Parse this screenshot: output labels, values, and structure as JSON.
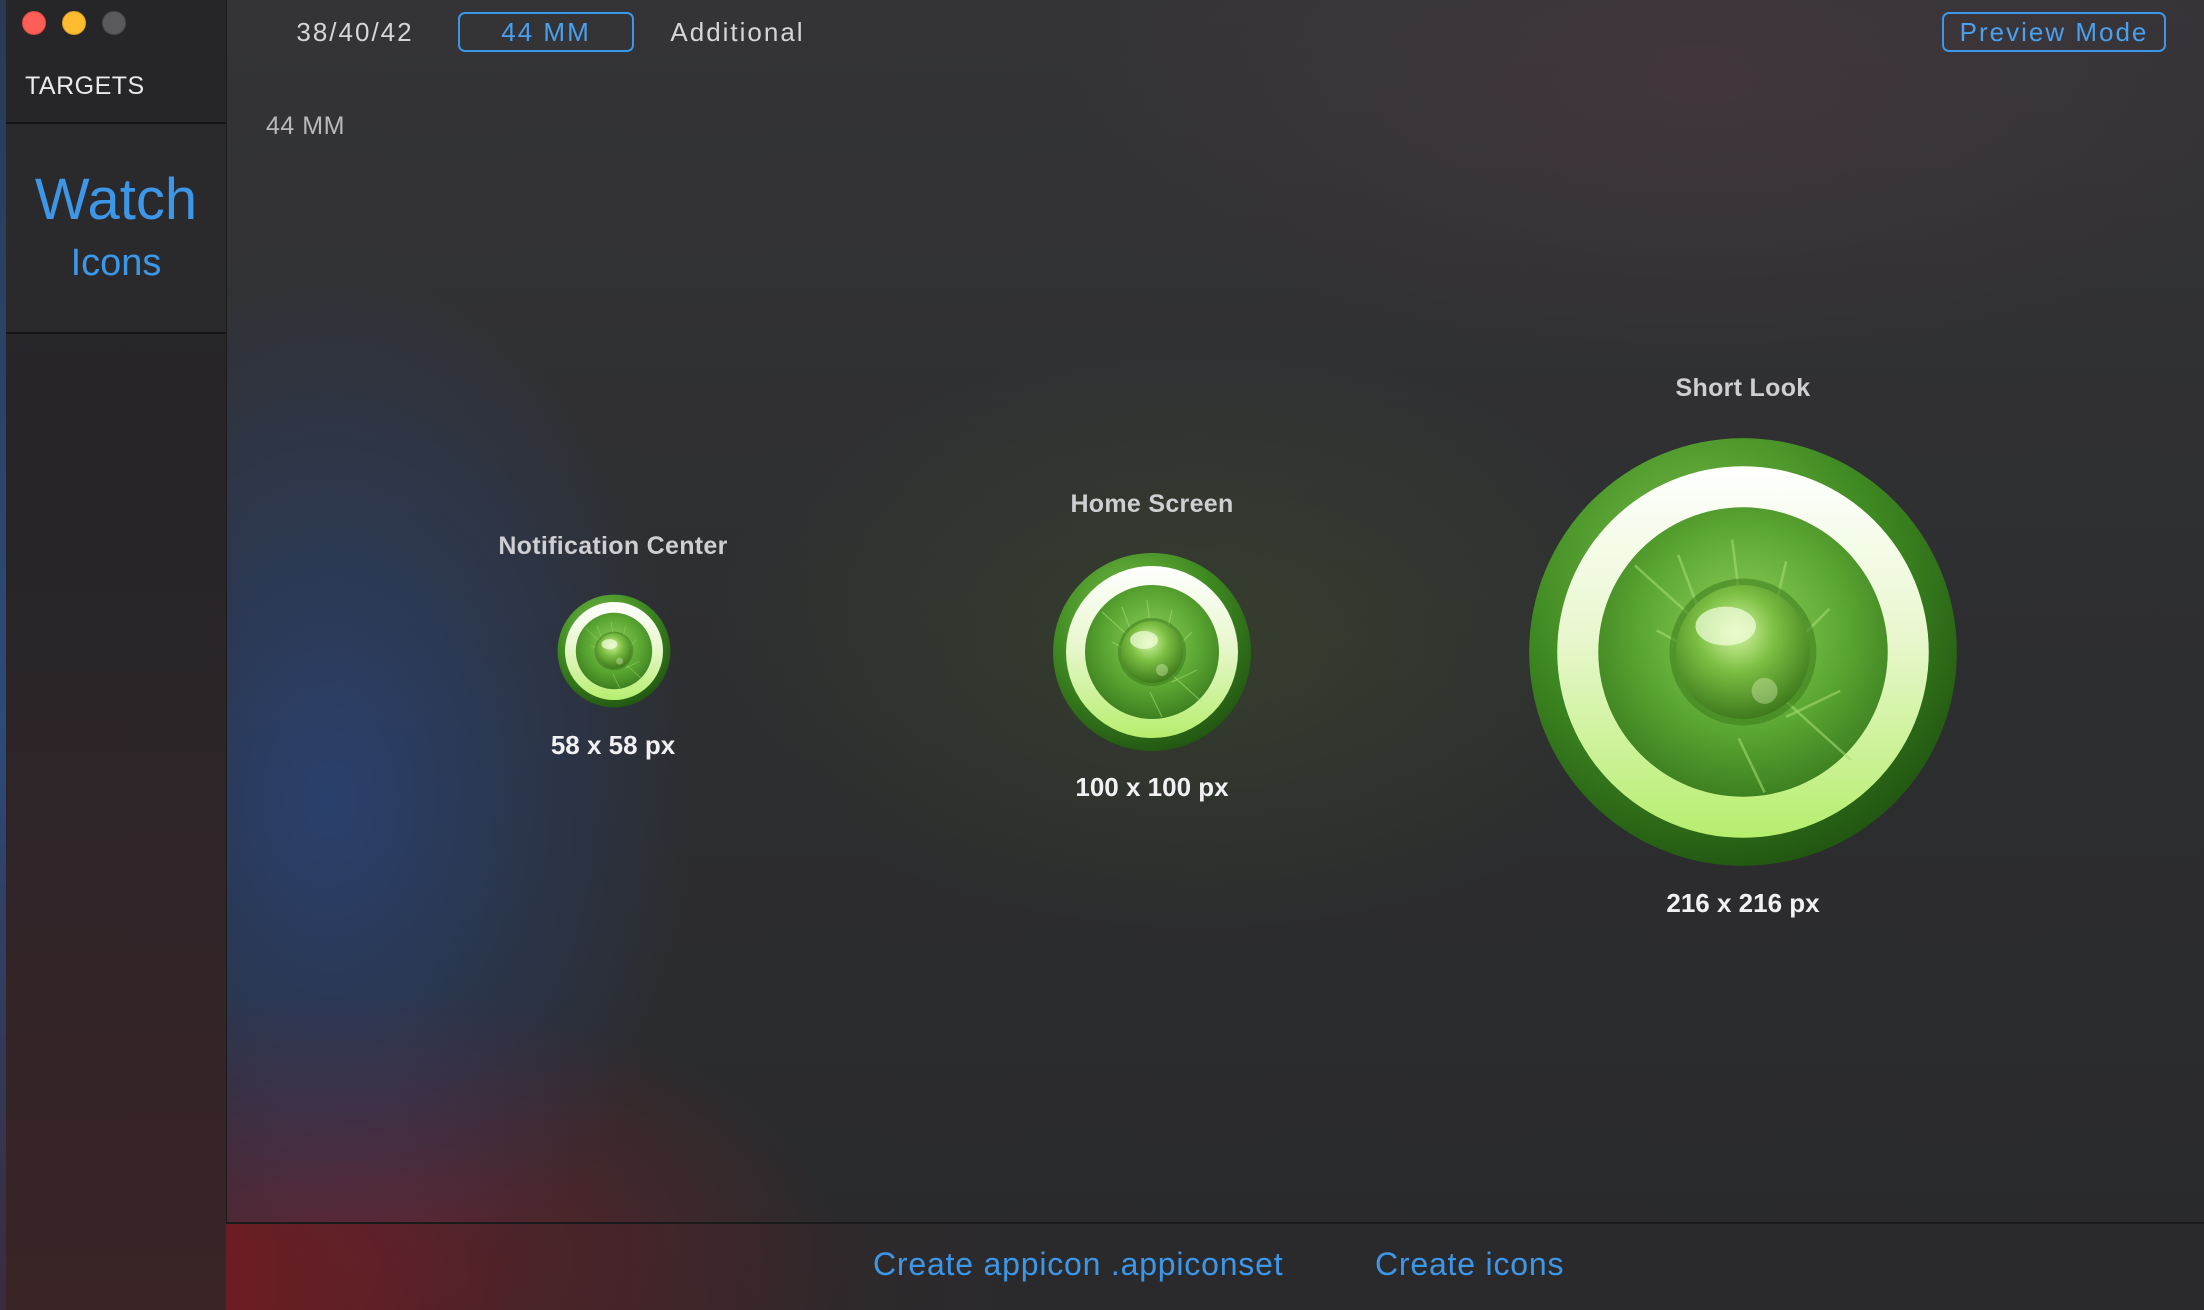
{
  "window": {
    "traffic_lights": [
      "close",
      "minimize",
      "zoom"
    ]
  },
  "sidebar": {
    "header": "TARGETS",
    "selected_target": {
      "title": "Watch",
      "subtitle": "Icons"
    }
  },
  "toolbar": {
    "segments": [
      "38/40/42",
      "44 MM",
      "Additional"
    ],
    "selected_segment": "44 MM",
    "preview_button": "Preview Mode"
  },
  "main": {
    "section_label": "44 MM",
    "icons": [
      {
        "label": "Notification Center",
        "size": "58 x 58 px"
      },
      {
        "label": "Home Screen",
        "size": "100 x 100 px"
      },
      {
        "label": "Short Look",
        "size": "216 x 216 px"
      }
    ]
  },
  "footer": {
    "create_appiconset": "Create appicon .appiconset",
    "create_icons": "Create icons"
  },
  "colors": {
    "accent": "#3d97e8",
    "background": "#2c2d2f",
    "sidebar": "#262628",
    "icon_green": "#4e9a2a"
  }
}
